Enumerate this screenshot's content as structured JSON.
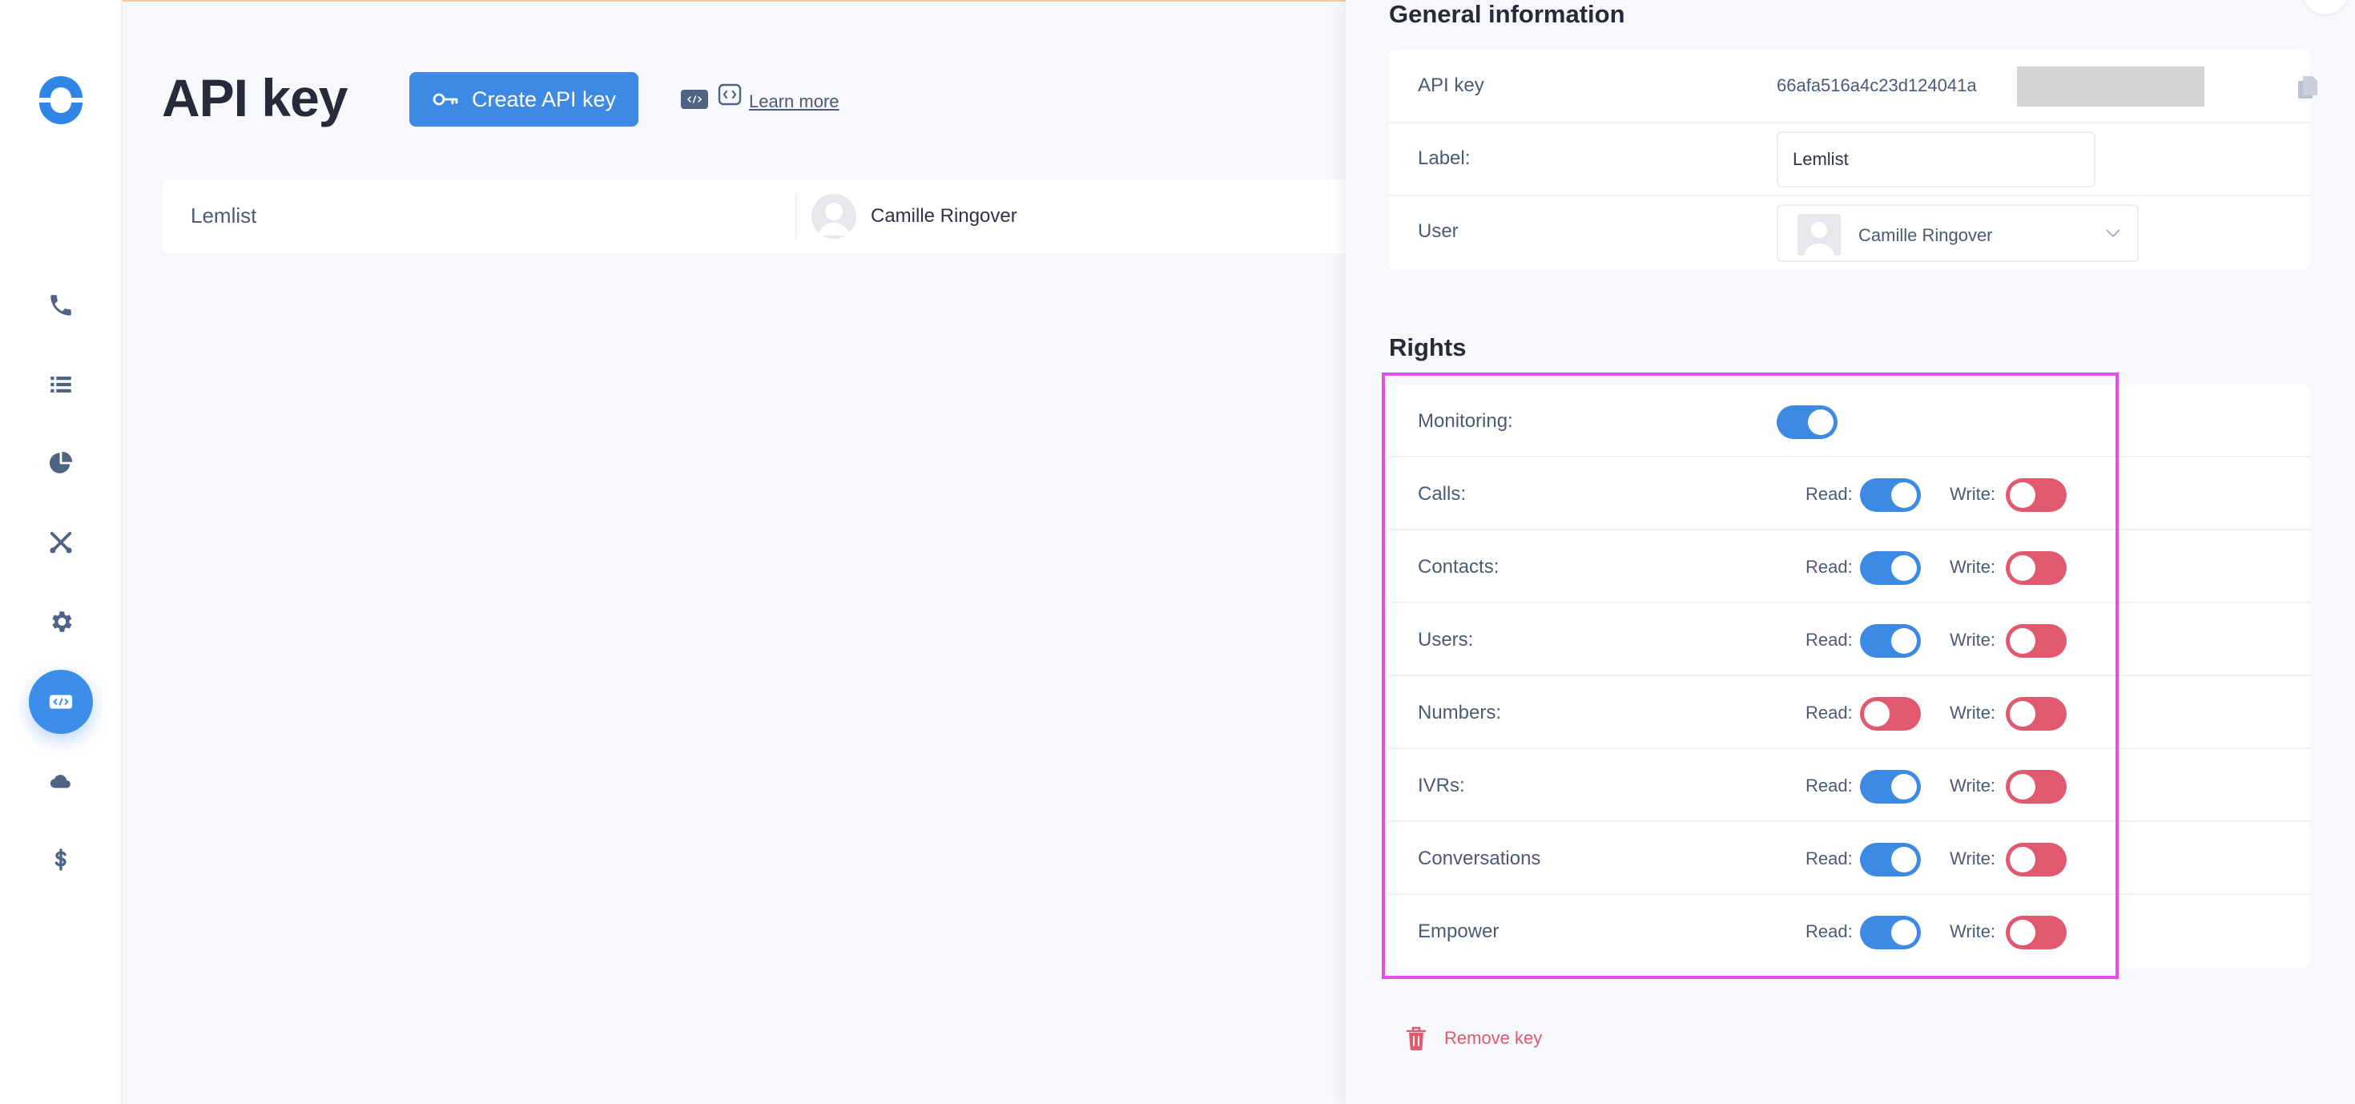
{
  "page": {
    "title": "API key",
    "create_button_label": "Create API key",
    "learn_more_label": "Learn more"
  },
  "keys_list": [
    {
      "label": "Lemlist",
      "user": "Camille Ringover"
    }
  ],
  "sidebar": {
    "items": [
      {
        "icon": "phone-icon"
      },
      {
        "icon": "list-icon"
      },
      {
        "icon": "pie-chart-icon"
      },
      {
        "icon": "crossed-tools-icon"
      },
      {
        "icon": "gear-icon"
      },
      {
        "icon": "code-icon",
        "active": true
      },
      {
        "icon": "cloud-icon"
      },
      {
        "icon": "dollar-icon"
      }
    ]
  },
  "panel": {
    "general_title": "General information",
    "api_key_label": "API key",
    "api_key_value": "66afa516a4c23d124041a",
    "label_label": "Label:",
    "label_value": "Lemlist",
    "user_label": "User",
    "user_value": "Camille Ringover",
    "rights_title": "Rights",
    "monitoring_label": "Monitoring:",
    "monitoring_on": true,
    "read_label": "Read:",
    "write_label": "Write:",
    "rights": [
      {
        "label": "Calls:",
        "read": true,
        "write": false
      },
      {
        "label": "Contacts:",
        "read": true,
        "write": false
      },
      {
        "label": "Users:",
        "read": true,
        "write": false
      },
      {
        "label": "Numbers:",
        "read": false,
        "write": false
      },
      {
        "label": "IVRs:",
        "read": true,
        "write": false
      },
      {
        "label": "Conversations",
        "read": true,
        "write": false
      },
      {
        "label": "Empower",
        "read": true,
        "write": false
      }
    ],
    "remove_label": "Remove key"
  },
  "colors": {
    "accent": "#3d8ae4",
    "danger": "#e0596f",
    "highlight": "#e84de8"
  }
}
